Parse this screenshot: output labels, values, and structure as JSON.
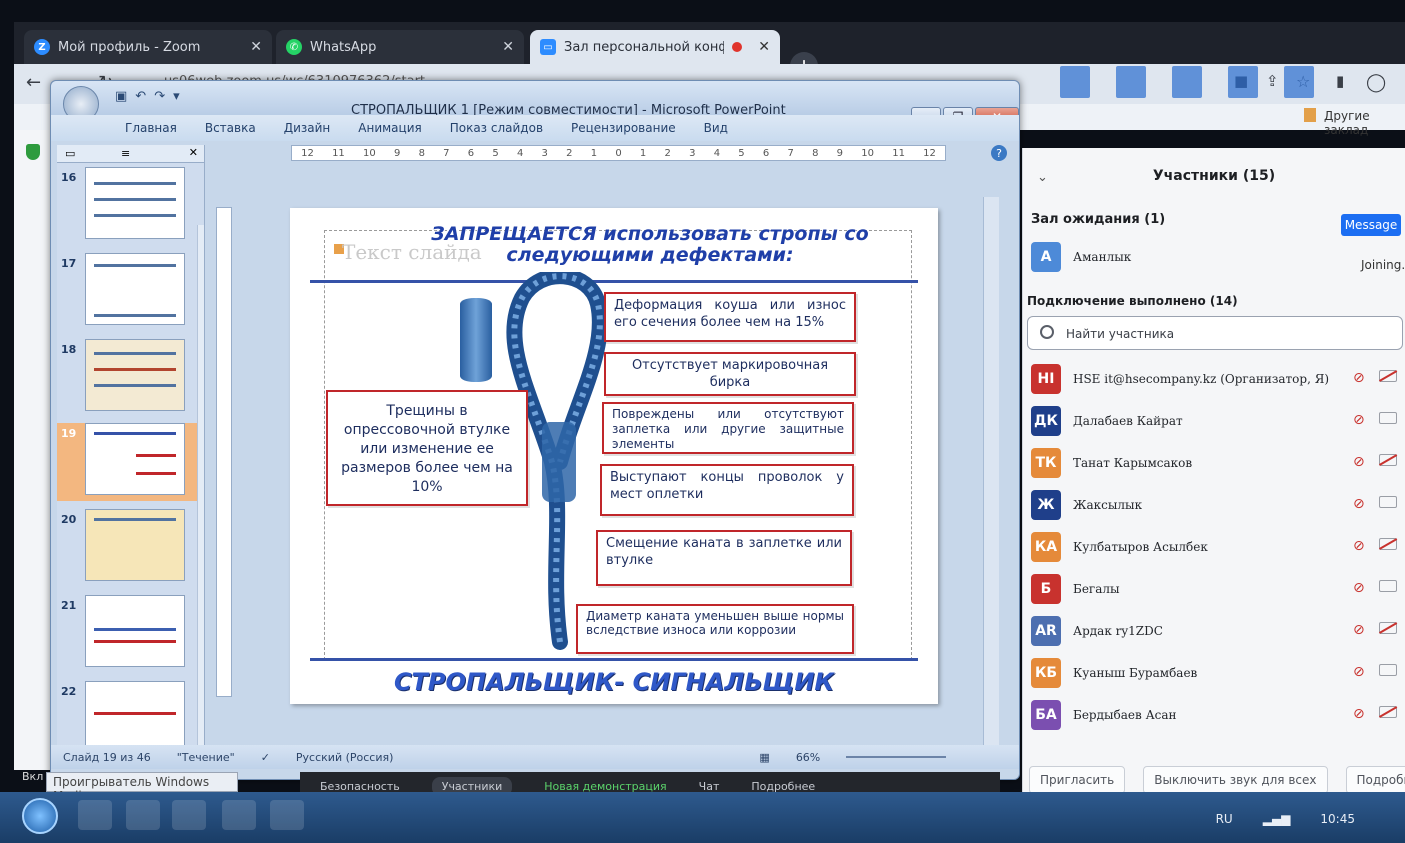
{
  "browser": {
    "tabs": [
      {
        "label": "Мой профиль - Zoom",
        "icon": "zoom-icon"
      },
      {
        "label": "WhatsApp",
        "icon": "whatsapp-icon"
      },
      {
        "label": "Зал персональной конфере",
        "icon": "zoom-meeting-icon"
      }
    ],
    "url": "us06web.zoom.us/wc/6310976362/start",
    "bookmarks_other": "Другие заклад"
  },
  "powerpoint": {
    "title": "СТРОПАЛЬЩИК 1 [Режим совместимости] - Microsoft PowerPoint",
    "ribbon_tabs": [
      "Главная",
      "Вставка",
      "Дизайн",
      "Анимация",
      "Показ слайдов",
      "Рецензирование",
      "Вид"
    ],
    "ruler_marks": [
      "12",
      "11",
      "10",
      "9",
      "8",
      "7",
      "6",
      "5",
      "4",
      "3",
      "2",
      "1",
      "0",
      "1",
      "2",
      "3",
      "4",
      "5",
      "6",
      "7",
      "8",
      "9",
      "10",
      "11",
      "12"
    ],
    "thumbnails": [
      "16",
      "17",
      "18",
      "19",
      "20",
      "21",
      "22"
    ],
    "selected_slide": "19",
    "status": {
      "slide": "Слайд 19 из 46",
      "theme": "\"Течение\"",
      "language": "Русский (Россия)",
      "zoom": "66%"
    }
  },
  "slide": {
    "title": "ЗАПРЕЩАЕТСЯ использовать стропы со следующими дефектами:",
    "placeholder": "Текст слайда",
    "callouts": [
      "Деформация коуша или износ его сечения более чем на 15%",
      "Отсутствует маркировочная бирка",
      "Повреждены или отсутствуют заплетка или другие защитные элементы",
      "Выступают концы проволок у мест оплетки",
      "Смещение каната в заплетке или втулке",
      "Диаметр каната уменьшен выше нормы вследствие износа или коррозии",
      "Трещины в опрессовочной втулке или изменение ее размеров более чем на 10%"
    ],
    "footer": "СТРОПАЛЬЩИК- СИГНАЛЬЩИК"
  },
  "zoom_panel": {
    "header": "Участники (15)",
    "waiting_room": "Зал ожидания (1)",
    "message_btn": "Message",
    "waiting_user": {
      "initial": "A",
      "name": "Аманлык",
      "status": "Joining..."
    },
    "connected": "Подключение выполнено (14)",
    "search_placeholder": "Найти участника",
    "participants": [
      {
        "initials": "HI",
        "name": "HSE it@hsecompany.kz (Организатор, Я)",
        "color": "#c8322e"
      },
      {
        "initials": "ДК",
        "name": "Далабаев Кайрат",
        "color": "#1f3f8a"
      },
      {
        "initials": "ТК",
        "name": "Танат Карымсаков",
        "color": "#e58a3a"
      },
      {
        "initials": "Ж",
        "name": "Жаксылык",
        "color": "#1f3f8a"
      },
      {
        "initials": "КА",
        "name": "Кулбатыров Асылбек",
        "color": "#e58a3a"
      },
      {
        "initials": "Б",
        "name": "Бегалы",
        "color": "#c8322e"
      },
      {
        "initials": "AR",
        "name": "Ардак ry1ZDC",
        "color": "#4d6fb0"
      },
      {
        "initials": "КБ",
        "name": "Куаныш Бурамбаев",
        "color": "#e58a3a"
      },
      {
        "initials": "БА",
        "name": "Бердыбаев Асан",
        "color": "#7b4fb0"
      }
    ],
    "footer": {
      "invite": "Пригласить",
      "mute_all": "Выключить звук для всех",
      "more": "Подробнее"
    }
  },
  "zoom_toolbar": [
    "Безопасность",
    "Участники",
    "Новая демонстрация",
    "Чат",
    "Подробнее"
  ],
  "taskbar": {
    "wmp": "Проигрыватель Windows Media",
    "lang": "RU",
    "time": "10:45",
    "vkl": "Вкл"
  }
}
